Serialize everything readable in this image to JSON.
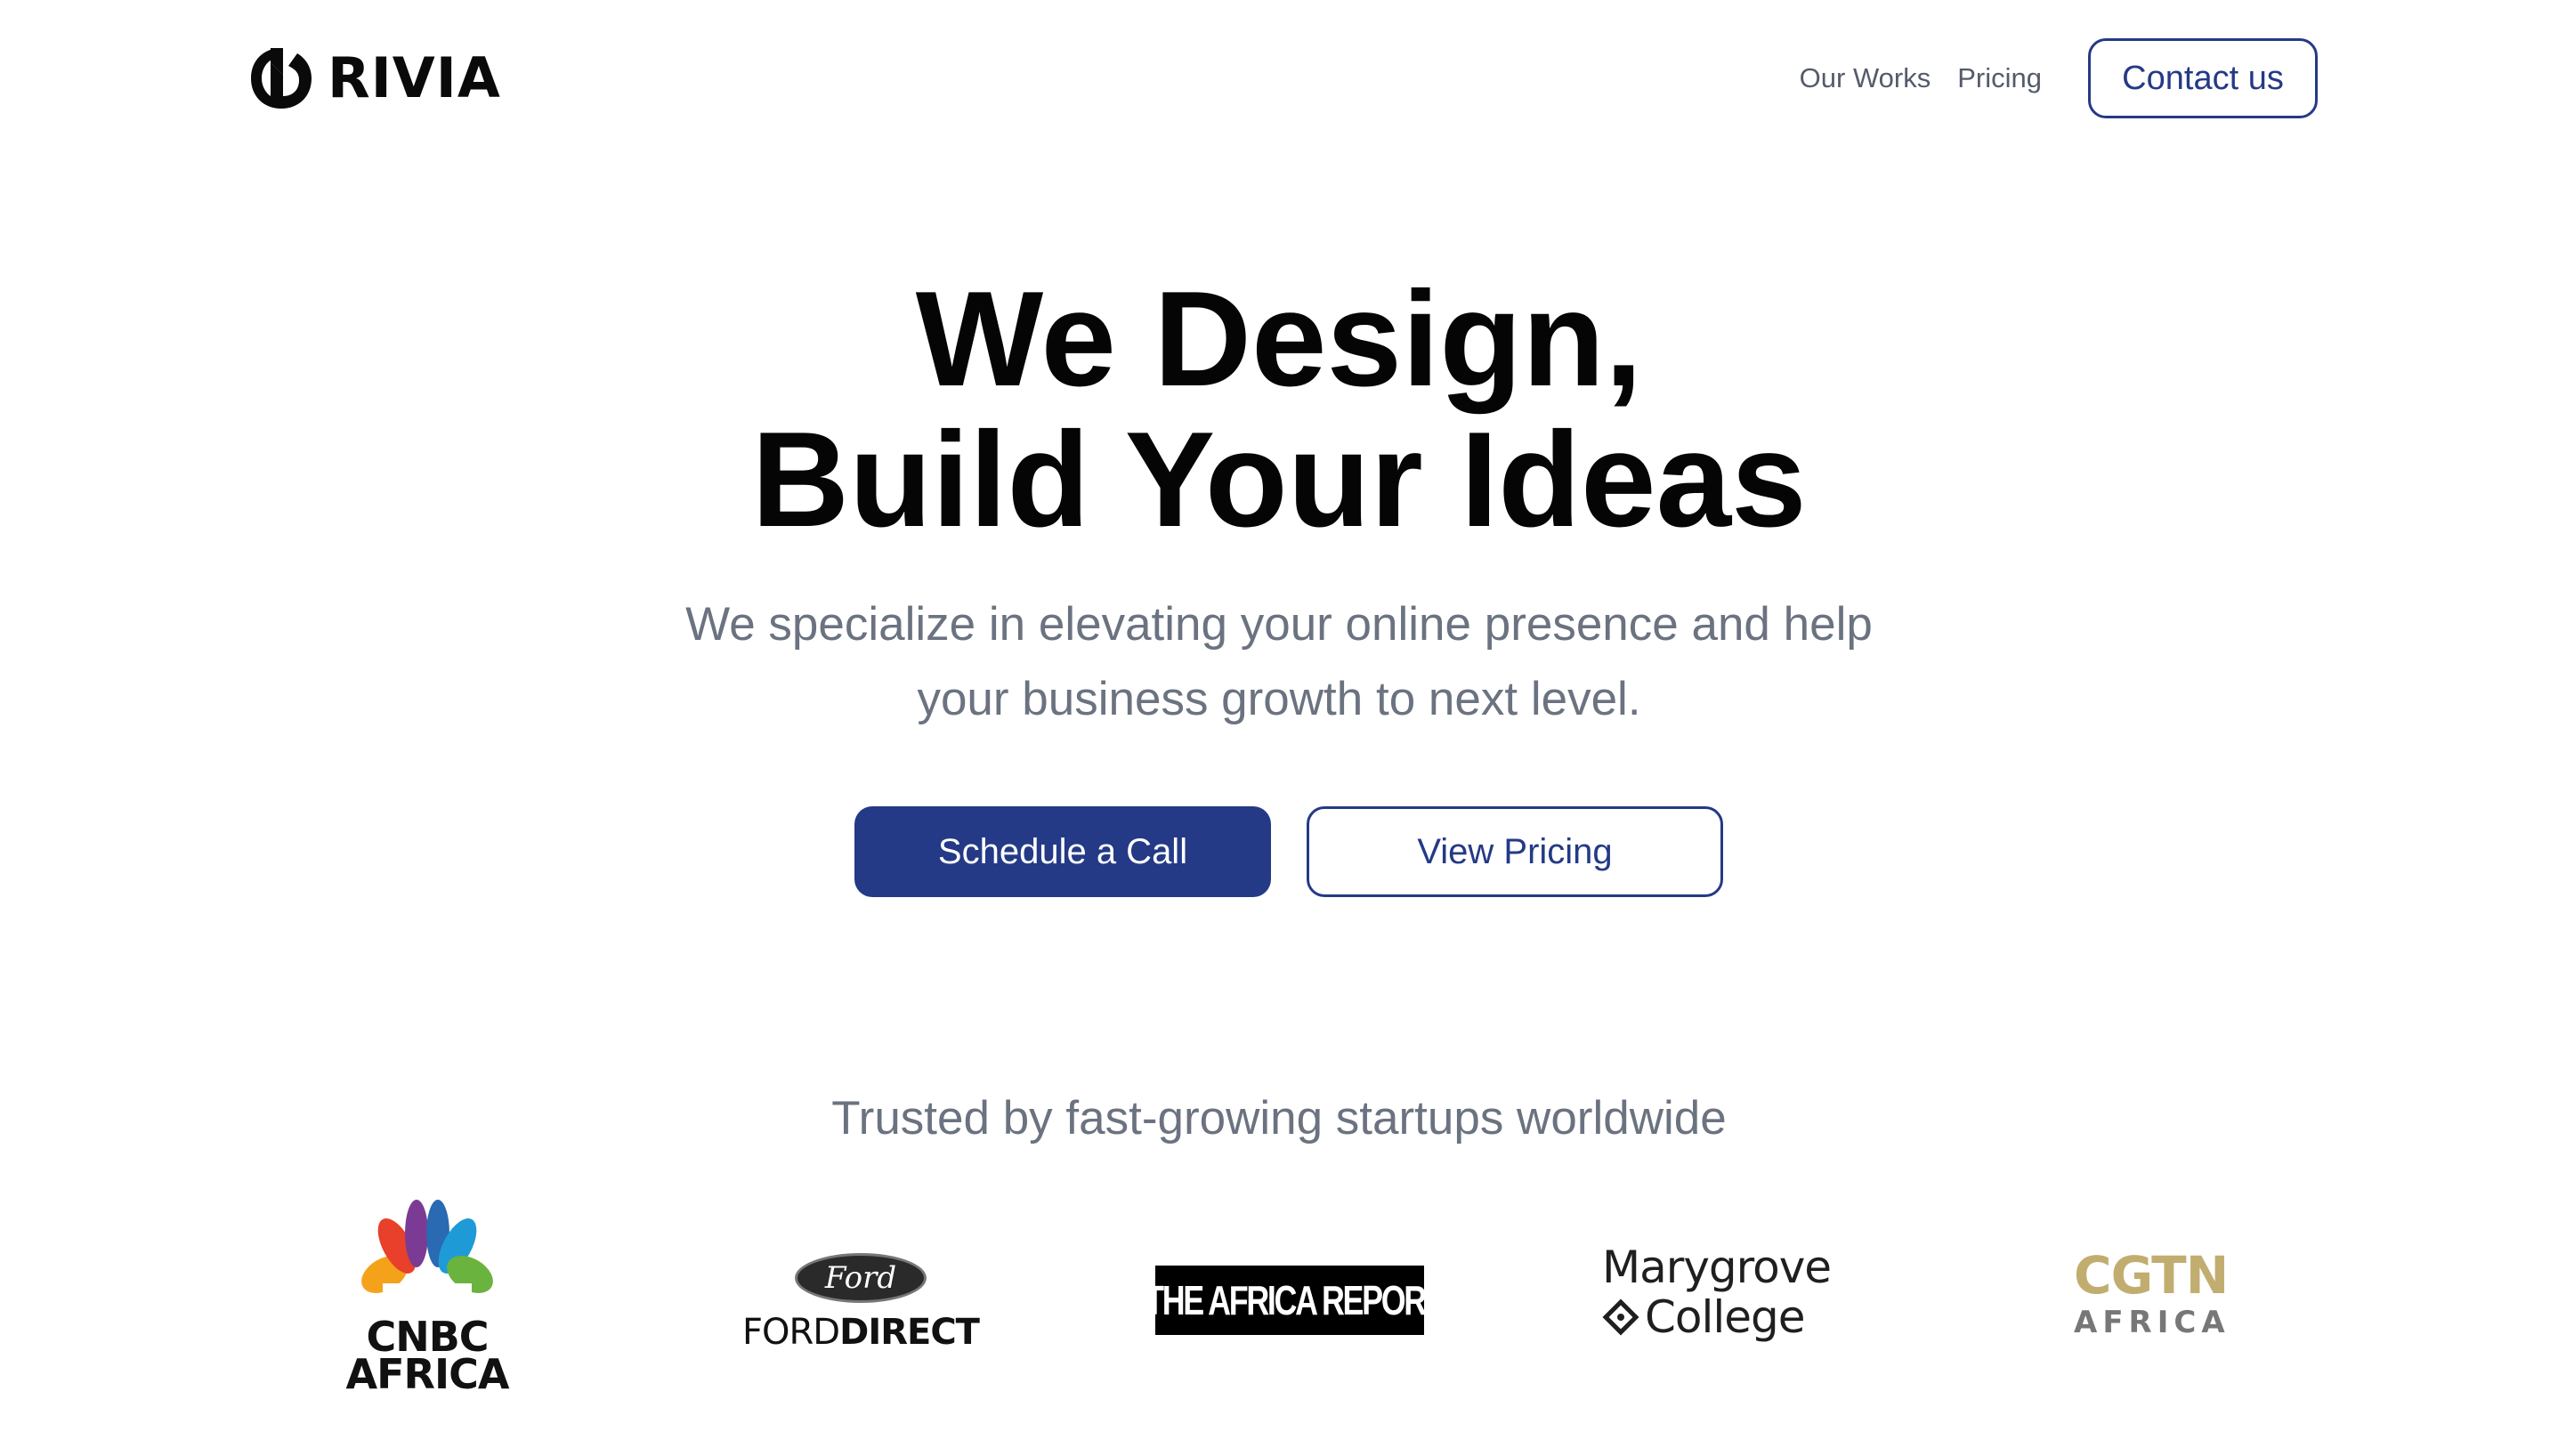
{
  "header": {
    "brand": "RIVIA",
    "nav": [
      {
        "label": "Our Works"
      },
      {
        "label": "Pricing"
      }
    ],
    "contact_label": "Contact us"
  },
  "hero": {
    "title_line1": "We Design,",
    "title_line2": "Build Your Ideas",
    "subtitle_line1": "We specialize in elevating your online presence and help",
    "subtitle_line2": "your business growth to next level.",
    "primary_cta": "Schedule a Call",
    "secondary_cta": "View Pricing"
  },
  "trusted": {
    "heading": "Trusted by fast-growing startups worldwide",
    "logos": [
      {
        "name": "CNBC Africa",
        "line1": "CNBC",
        "line2": "AFRICA"
      },
      {
        "name": "Ford Direct",
        "script": "Ford",
        "part1": "FORD",
        "part2": "DIRECT"
      },
      {
        "name": "The Africa Report",
        "text": "THE AFRICA REPORT"
      },
      {
        "name": "Marygrove College",
        "line1": "Marygrove",
        "line2": "College"
      },
      {
        "name": "CGTN Africa",
        "line1": "CGTN",
        "line2": "AFRICA"
      }
    ]
  },
  "colors": {
    "brand_blue": "#243a86",
    "muted_text": "#6b7280",
    "cgtn_gold": "#c2ad70"
  }
}
